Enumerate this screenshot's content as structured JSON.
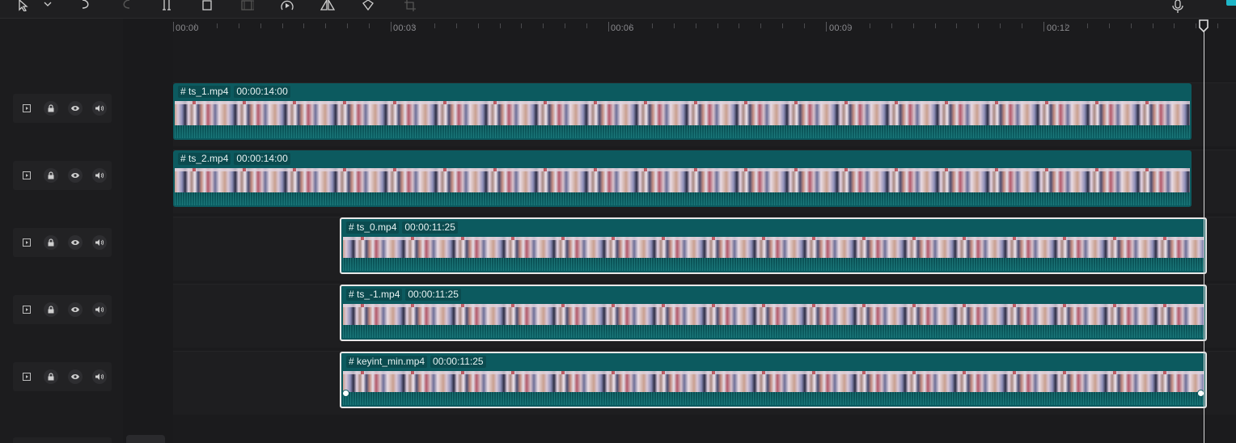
{
  "toolbar": {
    "items": [
      "select-tool",
      "dropdown",
      "undo",
      "redo",
      "split",
      "delete",
      "freeze",
      "speed",
      "mirror",
      "rotate",
      "crop",
      "mic",
      "top-right-badge"
    ]
  },
  "ruler": {
    "labels": [
      "00:00",
      "00:03",
      "00:06",
      "00:09",
      "00:12"
    ]
  },
  "tracks": [
    {
      "clip_name": "# ts_1.mp4",
      "duration": "00:00:14:00",
      "selected": false
    },
    {
      "clip_name": "# ts_2.mp4",
      "duration": "00:00:14:00",
      "selected": false
    },
    {
      "clip_name": "# ts_0.mp4",
      "duration": "00:00:11:25",
      "selected": true
    },
    {
      "clip_name": "# ts_-1.mp4",
      "duration": "00:00:11:25",
      "selected": true
    },
    {
      "clip_name": "# keyint_min.mp4",
      "duration": "00:00:11:25",
      "selected": true
    }
  ],
  "colors": {
    "clip": "#0c5a5f",
    "selection": "#e8e8e8",
    "accent": "#1fb6c8"
  }
}
